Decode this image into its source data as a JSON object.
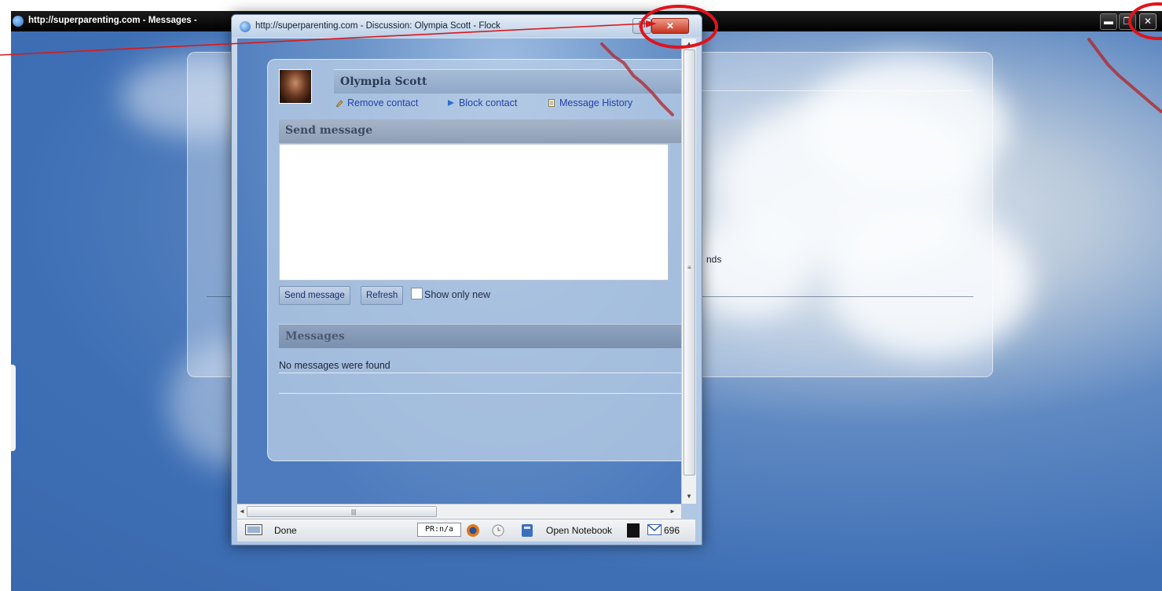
{
  "background_window": {
    "title": "http://superparenting.com - Messages -",
    "fragment_text": "nds",
    "controls": {
      "minimize": "▬",
      "restore": "❐",
      "close": "✕"
    }
  },
  "popup": {
    "title": "http://superparenting.com - Discussion: Olympia Scott - Flock",
    "controls": {
      "maximize": "❐",
      "close": "✕"
    },
    "contact": {
      "name": "Olympia Scott",
      "actions": [
        {
          "label": "Remove contact",
          "icon": "remove-contact-icon"
        },
        {
          "label": "Block contact",
          "icon": "block-contact-icon"
        },
        {
          "label": "Message History",
          "icon": "message-history-icon"
        }
      ]
    },
    "send_section": {
      "header": "Send message",
      "message_value": "",
      "send_button": "Send message",
      "refresh_button": "Refresh",
      "show_only_new_label": "Show only new",
      "show_only_new_checked": false
    },
    "messages_section": {
      "header": "Messages",
      "empty_text": "No messages were found"
    },
    "statusbar": {
      "status": "Done",
      "pr_indicator": "PR:n/a",
      "open_notebook": "Open Notebook",
      "mail_count": "696"
    },
    "scroll": {
      "vgrip": "≡",
      "hgrip": "|||",
      "up": "▲",
      "down": "▼",
      "left": "◄",
      "right": "►"
    }
  },
  "colors": {
    "annotation_red": "#e0141b",
    "link_blue": "#2242a8",
    "sky_blue": "#3e6fb5"
  }
}
